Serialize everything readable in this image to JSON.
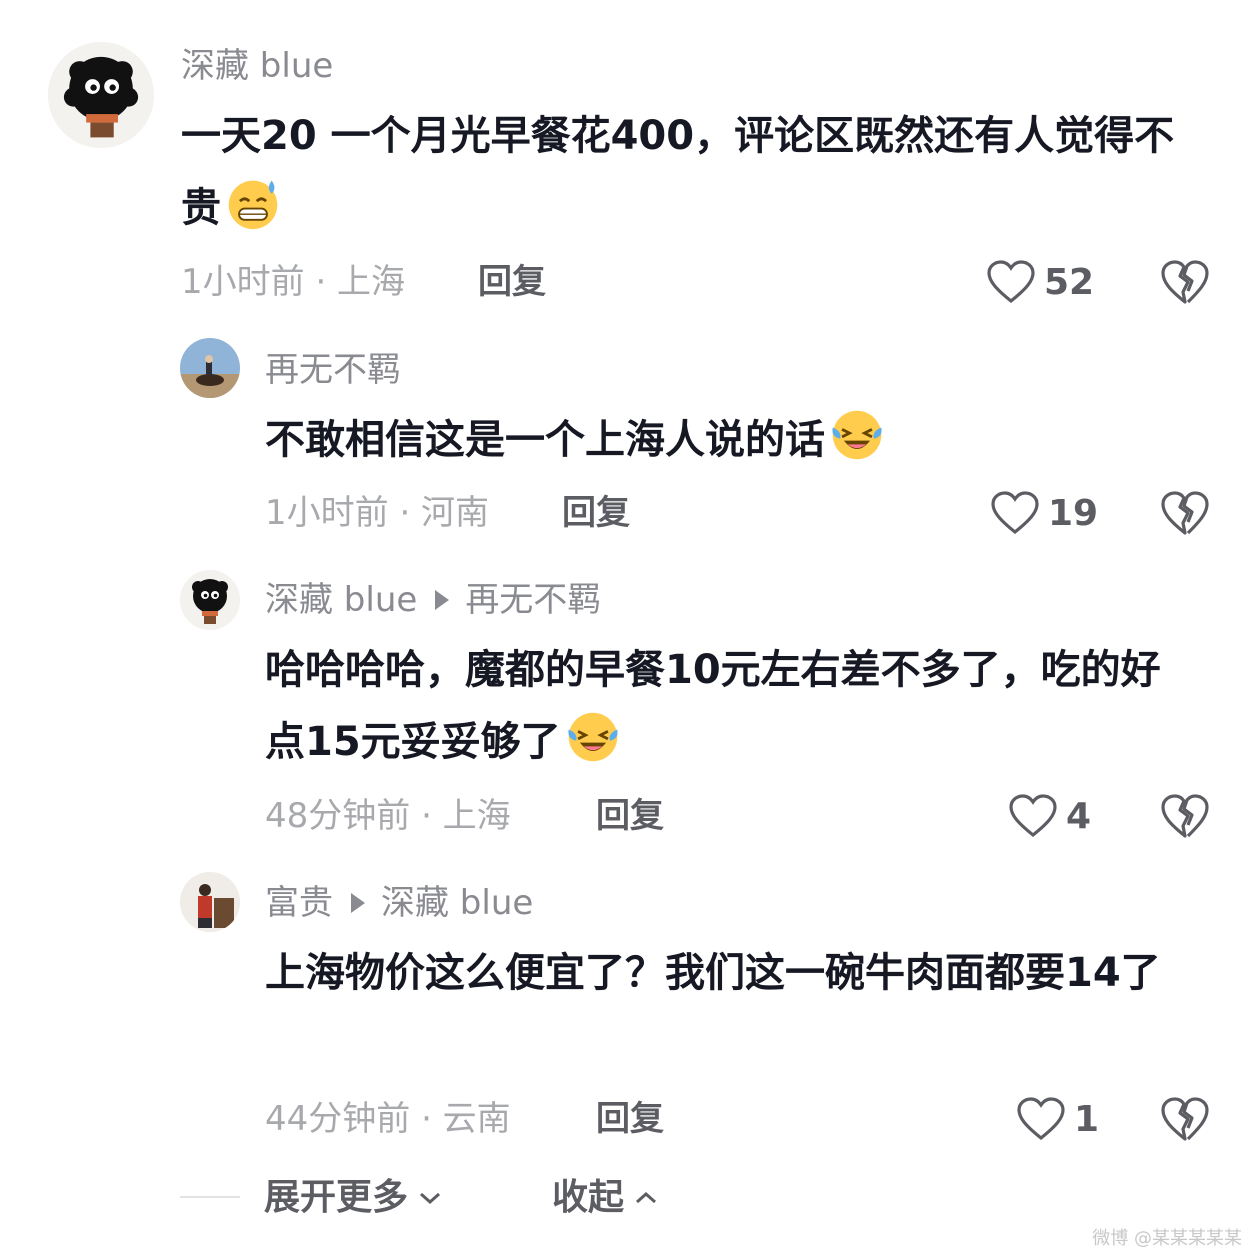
{
  "comments": [
    {
      "username": "深藏 blue",
      "text": "一天20 一个月光早餐花400，评论区既然还有人觉得不贵",
      "emoji": "grimacing-sweat",
      "time_location": "1小时前 · 上海",
      "reply_label": "回复",
      "likes": "52"
    },
    {
      "username": "再无不羁",
      "text": "不敢相信这是一个上海人说的话",
      "emoji": "laughing-tears",
      "time_location": "1小时前 · 河南",
      "reply_label": "回复",
      "likes": "19"
    },
    {
      "username": "深藏 blue",
      "reply_to": "再无不羁",
      "text": "哈哈哈哈，魔都的早餐10元左右差不多了，吃的好点15元妥妥够了",
      "emoji": "laughing-tears",
      "time_location": "48分钟前 · 上海",
      "reply_label": "回复",
      "likes": "4"
    },
    {
      "username": "富贵",
      "reply_to": "深藏 blue",
      "text": "上海物价这么便宜了？我们这一碗牛肉面都要14了",
      "time_location": "44分钟前 · 云南",
      "reply_label": "回复",
      "likes": "1"
    }
  ],
  "footer": {
    "expand_label": "展开更多",
    "collapse_label": "收起"
  },
  "watermark": "微博 @某某某某某"
}
